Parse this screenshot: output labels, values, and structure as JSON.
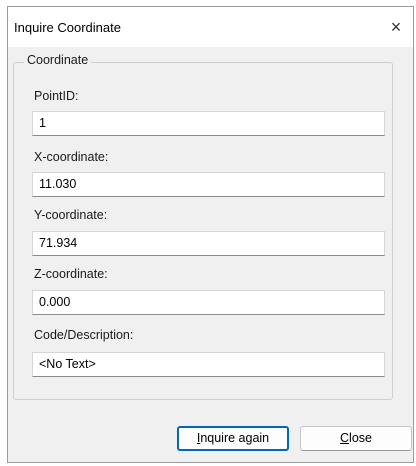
{
  "window": {
    "title": "Inquire Coordinate",
    "close_glyph": "×"
  },
  "group": {
    "title": "Coordinate"
  },
  "fields": [
    {
      "label": "PointID:",
      "value": "1"
    },
    {
      "label": "X-coordinate:",
      "value": "11.030"
    },
    {
      "label": "Y-coordinate:",
      "value": "71.934"
    },
    {
      "label": "Z-coordinate:",
      "value": "0.000"
    },
    {
      "label": "Code/Description:",
      "value": "<No Text>"
    }
  ],
  "buttons": {
    "inquire_again": {
      "mnemonic": "I",
      "rest": "nquire again"
    },
    "close": {
      "mnemonic": "C",
      "rest": "lose"
    }
  },
  "colors": {
    "dialog_bg": "#f0f0f0",
    "default_button_border": "#0067c0"
  },
  "icons": {
    "close": "close-icon"
  }
}
